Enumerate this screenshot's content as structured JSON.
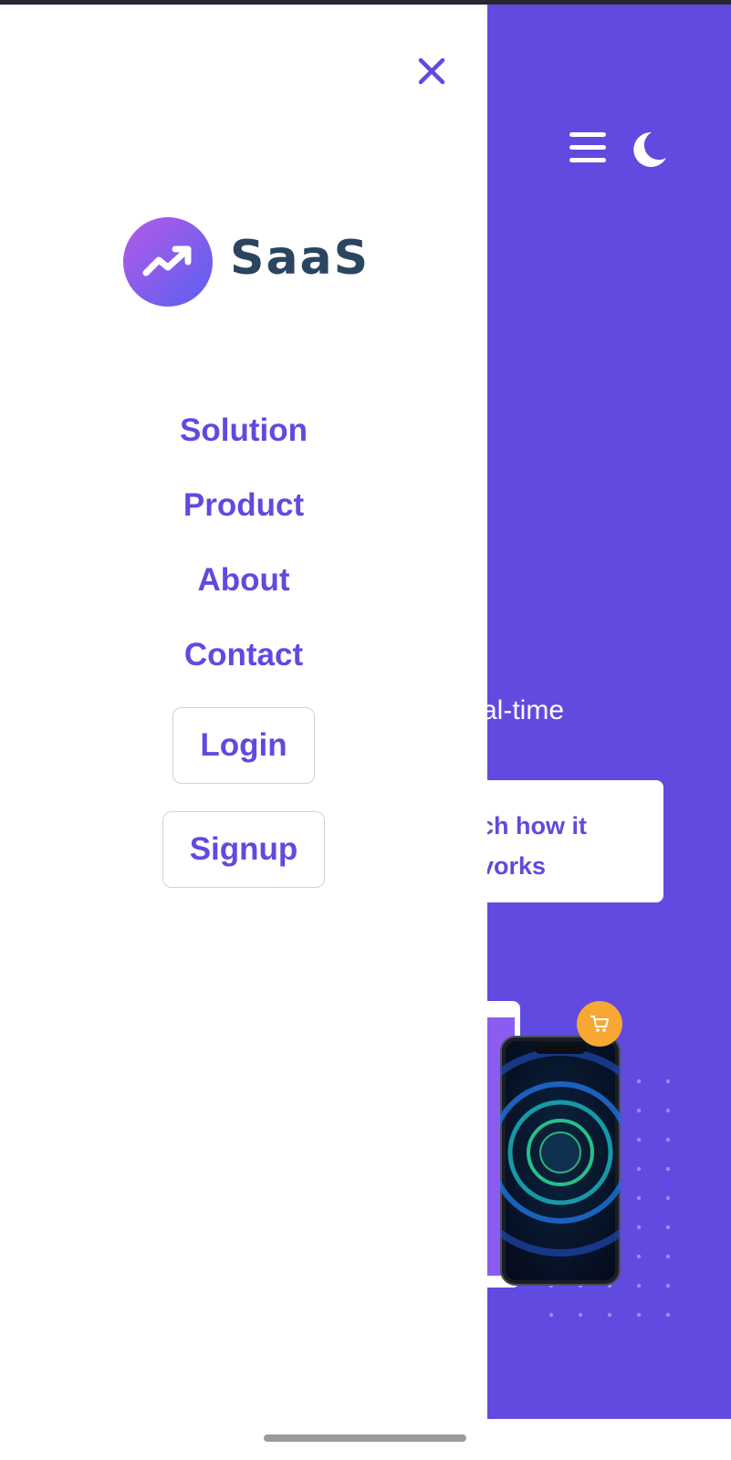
{
  "drawer": {
    "brand": "SaaS",
    "nav_links": [
      "Solution",
      "Product",
      "About",
      "Contact"
    ],
    "login_label": "Login",
    "signup_label": "Signup",
    "icons": {
      "close": "close-icon",
      "logo": "trending-up-icon"
    }
  },
  "hero": {
    "partial_text": "al-time",
    "watch_line1": "ch how it",
    "watch_line2": "vorks",
    "icons": {
      "menu": "hamburger-menu-icon",
      "theme": "moon-icon",
      "cart": "cart-icon"
    }
  },
  "colors": {
    "accent": "#604ae0",
    "brand_text": "#2b4560",
    "badge": "#f6a832",
    "white": "#ffffff"
  }
}
